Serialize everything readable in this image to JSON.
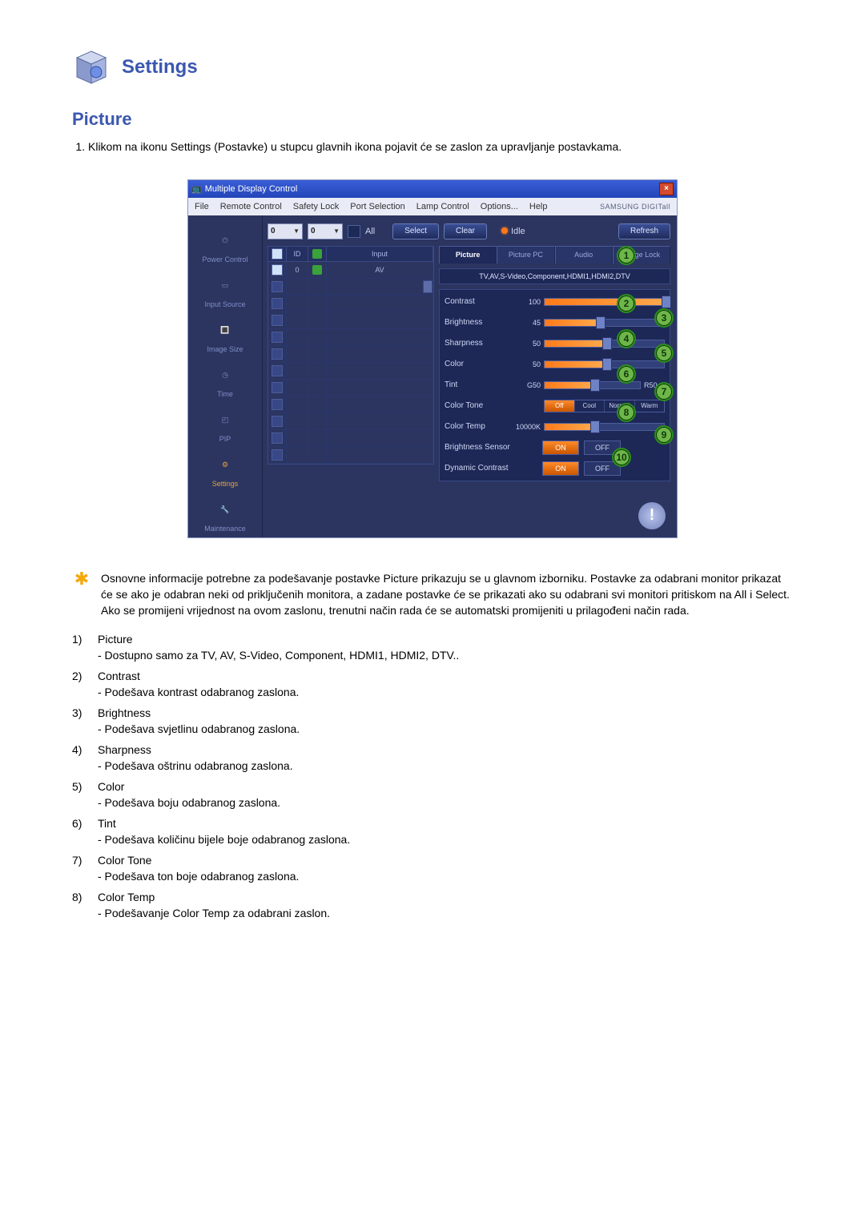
{
  "header": {
    "title": "Settings"
  },
  "section": {
    "title": "Picture",
    "intro": "Klikom na ikonu Settings (Postavke) u stupcu glavnih ikona pojavit će se zaslon za upravljanje postavkama."
  },
  "shot": {
    "window_title": "Multiple Display Control",
    "brand": "SAMSUNG DIGITall",
    "menubar": [
      "File",
      "Remote Control",
      "Safety Lock",
      "Port Selection",
      "Lamp Control",
      "Options...",
      "Help"
    ],
    "sidebar": [
      {
        "label": "Power Control",
        "active": false
      },
      {
        "label": "Input Source",
        "active": false
      },
      {
        "label": "Image Size",
        "active": false
      },
      {
        "label": "Time",
        "active": false
      },
      {
        "label": "PIP",
        "active": false
      },
      {
        "label": "Settings",
        "active": true
      },
      {
        "label": "Maintenance",
        "active": false
      }
    ],
    "toolbar": {
      "dd1": "0",
      "dd2": "0",
      "all": "All",
      "select": "Select",
      "clear": "Clear",
      "idle": "Idle",
      "refresh": "Refresh"
    },
    "table": {
      "headers": {
        "chk": "",
        "id": "ID",
        "status": "",
        "input": "Input"
      },
      "rows": [
        {
          "checked": true,
          "id": "0",
          "status": "green",
          "input": "AV"
        }
      ],
      "empty_rows": 11
    },
    "tabs": [
      "Picture",
      "Picture PC",
      "Audio",
      "Image Lock"
    ],
    "active_tab": 0,
    "info_line": "TV,AV,S-Video,Component,HDMI1,HDMI2,DTV",
    "params": {
      "contrast": {
        "label": "Contrast",
        "value": "100",
        "pct": 100
      },
      "brightness": {
        "label": "Brightness",
        "value": "45",
        "pct": 45
      },
      "sharpness": {
        "label": "Sharpness",
        "value": "50",
        "pct": 50
      },
      "color": {
        "label": "Color",
        "value": "50",
        "pct": 50
      },
      "tint": {
        "label": "Tint",
        "left": "G50",
        "right": "R50",
        "pct": 50
      },
      "tone": {
        "label": "Color Tone",
        "options": [
          "Off",
          "Cool",
          "Normal",
          "Warm"
        ],
        "active": 0
      },
      "temp": {
        "label": "Color Temp",
        "value": "10000K",
        "pct": 40
      },
      "bsensor": {
        "label": "Brightness Sensor",
        "on": "ON",
        "off": "OFF"
      },
      "dcontrast": {
        "label": "Dynamic Contrast",
        "on": "ON",
        "off": "OFF"
      }
    },
    "badges": [
      "1",
      "2",
      "3",
      "4",
      "5",
      "6",
      "7",
      "8",
      "9",
      "10"
    ]
  },
  "note": "Osnovne informacije potrebne za podešavanje postavke Picture prikazuju se u glavnom izborniku. Postavke za odabrani monitor prikazat će se ako je odabran neki od priključenih monitora, a zadane postavke će se prikazati ako su odabrani svi monitori pritiskom na All i Select. Ako se promijeni vrijednost na ovom zaslonu, trenutni način rada će se automatski promijeniti u prilagođeni način rada.",
  "items": [
    {
      "n": "1)",
      "t": "Picture",
      "sub": "- Dostupno samo za TV, AV, S-Video, Component, HDMI1, HDMI2, DTV.."
    },
    {
      "n": "2)",
      "t": "Contrast",
      "sub": "- Podešava kontrast odabranog zaslona."
    },
    {
      "n": "3)",
      "t": "Brightness",
      "sub": "- Podešava svjetlinu odabranog zaslona."
    },
    {
      "n": "4)",
      "t": "Sharpness",
      "sub": "- Podešava oštrinu odabranog zaslona."
    },
    {
      "n": "5)",
      "t": "Color",
      "sub": "- Podešava boju odabranog zaslona."
    },
    {
      "n": "6)",
      "t": "Tint",
      "sub": "- Podešava količinu bijele boje odabranog zaslona."
    },
    {
      "n": "7)",
      "t": "Color Tone",
      "sub": "- Podešava ton boje odabranog zaslona."
    },
    {
      "n": "8)",
      "t": "Color Temp",
      "sub": "- Podešavanje Color Temp za odabrani zaslon."
    }
  ]
}
